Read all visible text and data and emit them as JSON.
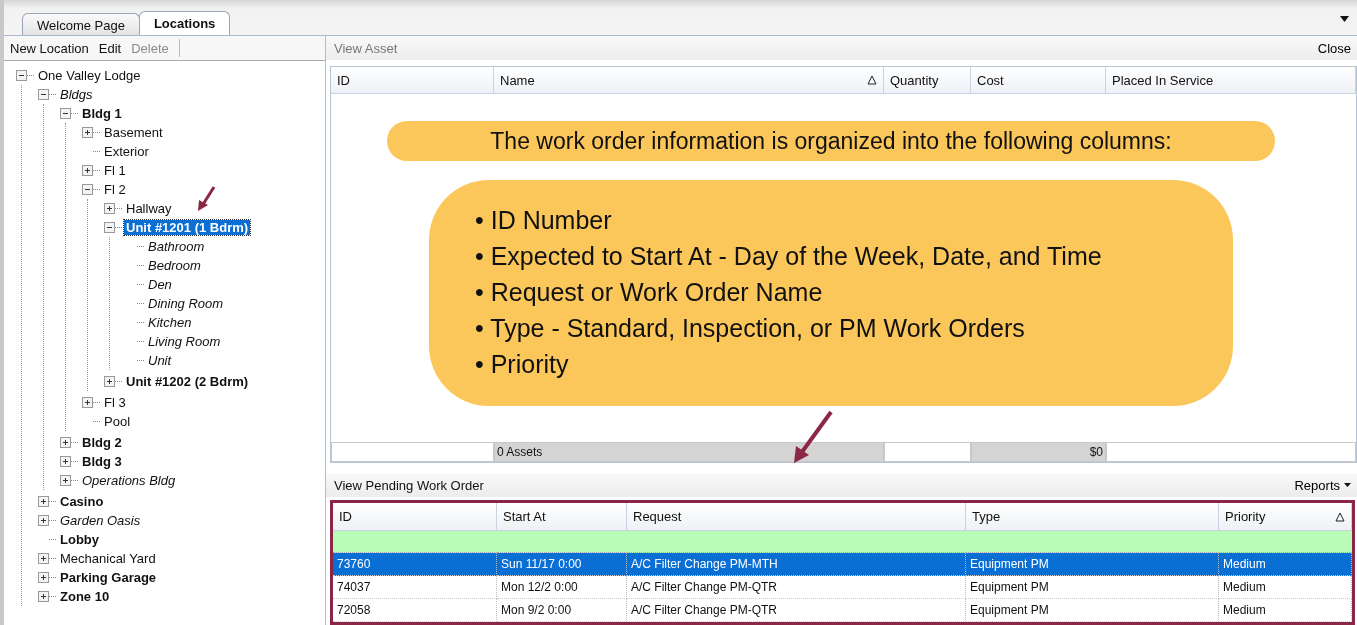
{
  "tabs": [
    {
      "label": "Welcome Page",
      "selected": false
    },
    {
      "label": "Locations",
      "selected": true
    }
  ],
  "toolbar": [
    {
      "label": "New Location",
      "disabled": false
    },
    {
      "label": "Edit",
      "disabled": false
    },
    {
      "label": "Delete",
      "disabled": true
    }
  ],
  "tree": [
    {
      "label": "One Valley Lodge",
      "kind": "plain",
      "expanded": true,
      "selected": false,
      "children": [
        {
          "label": "Bldgs",
          "kind": "italic",
          "expanded": true,
          "selected": false,
          "children": [
            {
              "label": "Bldg 1",
              "kind": "bold",
              "expanded": true,
              "selected": false,
              "children": [
                {
                  "label": "Basement",
                  "kind": "plain",
                  "expanded": false,
                  "selected": false
                },
                {
                  "label": "Exterior",
                  "kind": "plain",
                  "selected": false
                },
                {
                  "label": "Fl 1",
                  "kind": "plain",
                  "expanded": false,
                  "selected": false
                },
                {
                  "label": "Fl 2",
                  "kind": "plain",
                  "expanded": true,
                  "selected": false,
                  "children": [
                    {
                      "label": "Hallway",
                      "kind": "plain",
                      "expanded": false,
                      "selected": false
                    },
                    {
                      "label": "Unit #1201 (1 Bdrm)",
                      "kind": "bold",
                      "expanded": true,
                      "selected": true,
                      "children": [
                        {
                          "label": "Bathroom",
                          "kind": "italic",
                          "selected": false
                        },
                        {
                          "label": "Bedroom",
                          "kind": "italic",
                          "selected": false
                        },
                        {
                          "label": "Den",
                          "kind": "italic",
                          "selected": false
                        },
                        {
                          "label": "Dining Room",
                          "kind": "italic",
                          "selected": false
                        },
                        {
                          "label": "Kitchen",
                          "kind": "italic",
                          "selected": false
                        },
                        {
                          "label": "Living Room",
                          "kind": "italic",
                          "selected": false
                        },
                        {
                          "label": "Unit",
                          "kind": "italic",
                          "selected": false
                        }
                      ]
                    },
                    {
                      "label": "Unit #1202 (2 Bdrm)",
                      "kind": "bold",
                      "expanded": false,
                      "selected": false
                    }
                  ]
                },
                {
                  "label": "Fl 3",
                  "kind": "plain",
                  "expanded": false,
                  "selected": false
                },
                {
                  "label": "Pool",
                  "kind": "plain",
                  "selected": false
                }
              ]
            },
            {
              "label": "Bldg 2",
              "kind": "bold",
              "expanded": false,
              "selected": false
            },
            {
              "label": "Bldg 3",
              "kind": "bold",
              "expanded": false,
              "selected": false
            },
            {
              "label": "Operations Bldg",
              "kind": "italic",
              "expanded": false,
              "selected": false
            }
          ]
        },
        {
          "label": "Casino",
          "kind": "bold",
          "expanded": false,
          "selected": false
        },
        {
          "label": "Garden Oasis",
          "kind": "italic",
          "expanded": false,
          "selected": false
        },
        {
          "label": "Lobby",
          "kind": "bold",
          "selected": false
        },
        {
          "label": "Mechanical Yard",
          "kind": "plain",
          "expanded": false,
          "selected": false
        },
        {
          "label": "Parking Garage",
          "kind": "bold",
          "expanded": false,
          "selected": false
        },
        {
          "label": "Zone 10",
          "kind": "bold",
          "expanded": false,
          "selected": false
        }
      ]
    }
  ],
  "asset_panel": {
    "title": "View Asset",
    "close": "Close",
    "columns": [
      {
        "label": "ID",
        "sorted": false
      },
      {
        "label": "Name",
        "sorted": true
      },
      {
        "label": "Quantity",
        "sorted": false
      },
      {
        "label": "Cost",
        "sorted": false
      },
      {
        "label": "Placed In Service",
        "sorted": false
      }
    ],
    "summary": {
      "name_total": "0 Assets",
      "cost_total": "$0"
    }
  },
  "work_order_panel": {
    "title": "View Pending Work Order",
    "reports": "Reports",
    "columns": [
      {
        "label": "ID",
        "sorted": false
      },
      {
        "label": "Start At",
        "sorted": false
      },
      {
        "label": "Request",
        "sorted": false
      },
      {
        "label": "Type",
        "sorted": false
      },
      {
        "label": "Priority",
        "sorted": true
      }
    ],
    "rows": [
      {
        "cells": [
          "73760",
          "Sun 11/17 0:00",
          "A/C Filter Change PM-MTH",
          "Equipment PM",
          "Medium"
        ],
        "selected": true
      },
      {
        "cells": [
          "74037",
          "Mon 12/2 0:00",
          "A/C Filter Change PM-QTR",
          "Equipment PM",
          "Medium"
        ],
        "selected": false
      },
      {
        "cells": [
          "72058",
          "Mon 9/2 0:00",
          "A/C Filter Change PM-QTR",
          "Equipment PM",
          "Medium"
        ],
        "selected": false
      }
    ]
  },
  "callout": {
    "heading": "The work order information is organized into the following columns:",
    "bullets": [
      "• ID Number",
      "• Expected to Start At - Day of the Week, Date, and Time",
      "• Request or Work Order Name",
      "• Type - Standard, Inspection, or PM Work Orders",
      "• Priority"
    ]
  }
}
